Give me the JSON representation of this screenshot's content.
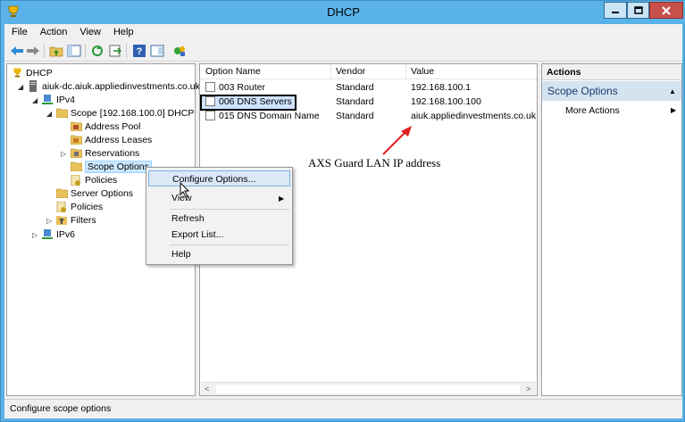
{
  "window": {
    "title": "DHCP",
    "controls": {
      "minimize": "–",
      "maximize": "□",
      "close": "✕"
    }
  },
  "menu": [
    "File",
    "Action",
    "View",
    "Help"
  ],
  "toolbar": {
    "icons": [
      "back-arrow-icon",
      "forward-arrow-icon",
      "up-folder-icon",
      "show-hide-tree-icon",
      "refresh-icon",
      "export-icon",
      "help-icon",
      "properties-icon",
      "server-icon"
    ]
  },
  "tree": {
    "root": "DHCP",
    "server": "aiuk-dc.aiuk.appliedinvestments.co.uk",
    "ipv4": "IPv4",
    "scope": "Scope [192.168.100.0] DHCP",
    "address_pool": "Address Pool",
    "address_leases": "Address Leases",
    "reservations": "Reservations",
    "scope_options": "Scope Options",
    "scope_policies": "Policies",
    "server_options": "Server Options",
    "policies": "Policies",
    "filters": "Filters",
    "ipv6": "IPv6"
  },
  "list": {
    "columns": [
      "Option Name",
      "Vendor",
      "Value"
    ],
    "rows": [
      {
        "name": "003 Router",
        "vendor": "Standard",
        "value": "192.168.100.1"
      },
      {
        "name": "006 DNS Servers",
        "vendor": "Standard",
        "value": "192.168.100.100"
      },
      {
        "name": "015 DNS Domain Name",
        "vendor": "Standard",
        "value": "aiuk.appliedinvestments.co.uk"
      }
    ]
  },
  "annotation": {
    "text": "AXS Guard LAN IP address",
    "color": "#e02020"
  },
  "actions": {
    "header": "Actions",
    "section": "Scope Options",
    "item": "More Actions"
  },
  "context_menu": {
    "items": [
      "Configure Options...",
      "View",
      "Refresh",
      "Export List...",
      "Help"
    ]
  },
  "status": {
    "text": "Configure scope options"
  },
  "colors": {
    "titlebar": "#5ab3e8",
    "close_button": "#c7504a",
    "selection": "#cce8ff",
    "actions_section": "#d4e3f0"
  }
}
